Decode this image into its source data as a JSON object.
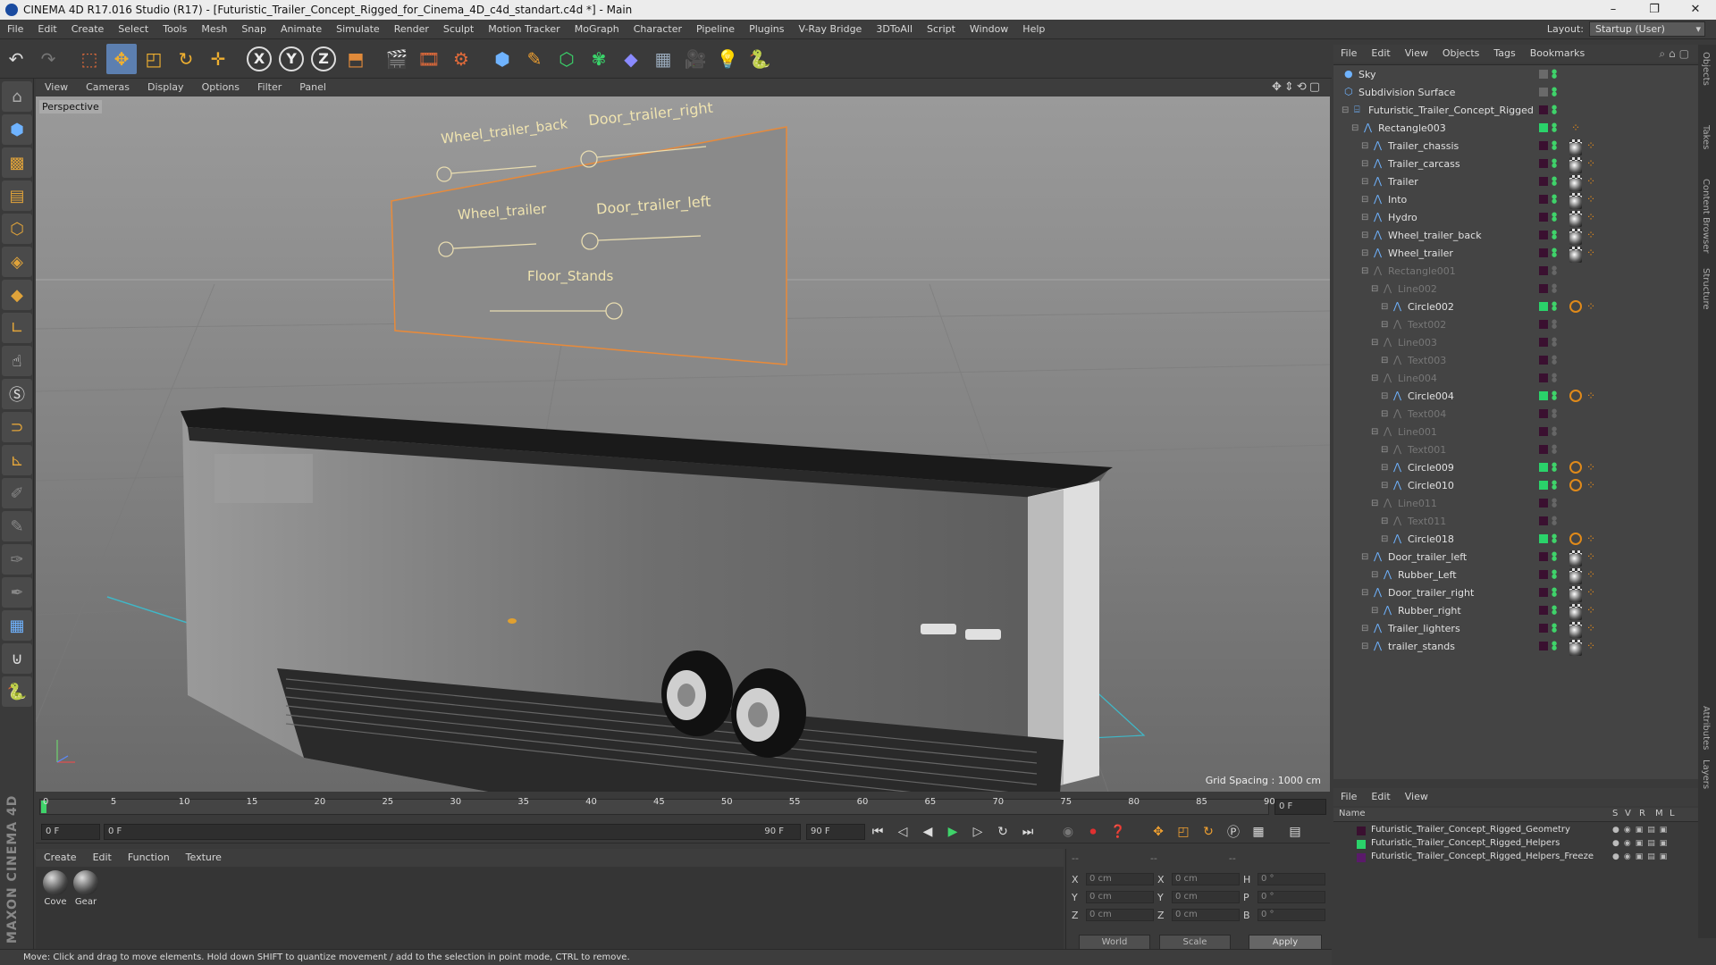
{
  "window": {
    "title": "CINEMA 4D R17.016 Studio (R17) - [Futuristic_Trailer_Concept_Rigged_for_Cinema_4D_c4d_standart.c4d *] - Main",
    "minimize": "–",
    "maximize": "❐",
    "close": "✕"
  },
  "menu": {
    "items": [
      "File",
      "Edit",
      "Create",
      "Select",
      "Tools",
      "Mesh",
      "Snap",
      "Animate",
      "Simulate",
      "Render",
      "Sculpt",
      "Motion Tracker",
      "MoGraph",
      "Character",
      "Pipeline",
      "Plugins",
      "V-Ray Bridge",
      "3DToAll",
      "Script",
      "Window",
      "Help"
    ],
    "layout_label": "Layout:",
    "layout_value": "Startup (User)"
  },
  "toolbar": {
    "axis_x": "X",
    "axis_y": "Y",
    "axis_z": "Z"
  },
  "viewport": {
    "menu": [
      "View",
      "Cameras",
      "Display",
      "Options",
      "Filter",
      "Panel"
    ],
    "label": "Perspective",
    "grid_spacing": "Grid Spacing : 1000 cm",
    "controls": {
      "wheel_trailer_back": "Wheel_trailer_back",
      "door_trailer_right": "Door_trailer_right",
      "wheel_trailer": "Wheel_trailer",
      "door_trailer_left": "Door_trailer_left",
      "floor_stands": "Floor_Stands"
    }
  },
  "timeline": {
    "ticks": [
      "0",
      "5",
      "10",
      "15",
      "20",
      "25",
      "30",
      "35",
      "40",
      "45",
      "50",
      "55",
      "60",
      "65",
      "70",
      "75",
      "80",
      "85",
      "90"
    ],
    "current_frame": "0 F",
    "start_frame": "0 F",
    "range_start": "0 F",
    "range_end": "90 F",
    "end_frame": "90 F"
  },
  "materials": {
    "menu": [
      "Create",
      "Edit",
      "Function",
      "Texture"
    ],
    "items": [
      "Cove",
      "Gear"
    ]
  },
  "coordinates": {
    "header": [
      "--",
      "--",
      "--"
    ],
    "rows": [
      {
        "a": "X",
        "av": "0 cm",
        "b": "X",
        "bv": "0 cm",
        "c": "H",
        "cv": "0 °"
      },
      {
        "a": "Y",
        "av": "0 cm",
        "b": "Y",
        "bv": "0 cm",
        "c": "P",
        "cv": "0 °"
      },
      {
        "a": "Z",
        "av": "0 cm",
        "b": "Z",
        "bv": "0 cm",
        "c": "B",
        "cv": "0 °"
      }
    ],
    "world": "World",
    "scale": "Scale",
    "apply": "Apply"
  },
  "status": "Move: Click and drag to move elements. Hold down SHIFT to quantize movement / add to the selection in point mode, CTRL to remove.",
  "objects": {
    "menu": [
      "File",
      "Edit",
      "View",
      "Objects",
      "Tags",
      "Bookmarks"
    ],
    "rows": [
      {
        "name": "Sky",
        "depth": 0,
        "dim": false,
        "swatch": "",
        "tags": []
      },
      {
        "name": "Subdivision Surface",
        "depth": 0,
        "dim": false,
        "swatch": "",
        "tags": []
      },
      {
        "name": "Futuristic_Trailer_Concept_Rigged",
        "depth": 1,
        "dim": false,
        "swatch": "#3a1030",
        "tags": []
      },
      {
        "name": "Rectangle003",
        "depth": 2,
        "dim": false,
        "swatch": "#2ad36a",
        "tags": [
          "ik"
        ]
      },
      {
        "name": "Trailer_chassis",
        "depth": 3,
        "dim": false,
        "swatch": "#3a1030",
        "tags": [
          "mat",
          "chk",
          "ik"
        ]
      },
      {
        "name": "Trailer_carcass",
        "depth": 3,
        "dim": false,
        "swatch": "#3a1030",
        "tags": [
          "mat",
          "chk",
          "ik"
        ]
      },
      {
        "name": "Trailer",
        "depth": 3,
        "dim": false,
        "swatch": "#3a1030",
        "tags": [
          "mat",
          "chk",
          "ik"
        ]
      },
      {
        "name": "Into",
        "depth": 3,
        "dim": false,
        "swatch": "#3a1030",
        "tags": [
          "mat",
          "chk",
          "ik"
        ]
      },
      {
        "name": "Hydro",
        "depth": 3,
        "dim": false,
        "swatch": "#3a1030",
        "tags": [
          "mat",
          "chk",
          "ik"
        ]
      },
      {
        "name": "Wheel_trailer_back",
        "depth": 3,
        "dim": false,
        "swatch": "#3a1030",
        "tags": [
          "dots",
          "mat",
          "chk",
          "ik"
        ]
      },
      {
        "name": "Wheel_trailer",
        "depth": 3,
        "dim": false,
        "swatch": "#3a1030",
        "tags": [
          "dots",
          "mat",
          "chk",
          "ik"
        ]
      },
      {
        "name": "Rectangle001",
        "depth": 3,
        "dim": true,
        "swatch": "#3a1030",
        "tags": []
      },
      {
        "name": "Line002",
        "depth": 4,
        "dim": true,
        "swatch": "#3a1030",
        "tags": []
      },
      {
        "name": "Circle002",
        "depth": 5,
        "dim": false,
        "swatch": "#2ad36a",
        "tags": [
          "no",
          "ik"
        ]
      },
      {
        "name": "Text002",
        "depth": 5,
        "dim": true,
        "swatch": "#3a1030",
        "tags": []
      },
      {
        "name": "Line003",
        "depth": 4,
        "dim": true,
        "swatch": "#3a1030",
        "tags": []
      },
      {
        "name": "Text003",
        "depth": 5,
        "dim": true,
        "swatch": "#3a1030",
        "tags": []
      },
      {
        "name": "Line004",
        "depth": 4,
        "dim": true,
        "swatch": "#3a1030",
        "tags": []
      },
      {
        "name": "Circle004",
        "depth": 5,
        "dim": false,
        "swatch": "#2ad36a",
        "tags": [
          "no",
          "ik"
        ]
      },
      {
        "name": "Text004",
        "depth": 5,
        "dim": true,
        "swatch": "#3a1030",
        "tags": []
      },
      {
        "name": "Line001",
        "depth": 4,
        "dim": true,
        "swatch": "#3a1030",
        "tags": []
      },
      {
        "name": "Text001",
        "depth": 5,
        "dim": true,
        "swatch": "#3a1030",
        "tags": []
      },
      {
        "name": "Circle009",
        "depth": 5,
        "dim": false,
        "swatch": "#2ad36a",
        "tags": [
          "no",
          "ik"
        ]
      },
      {
        "name": "Circle010",
        "depth": 5,
        "dim": false,
        "swatch": "#2ad36a",
        "tags": [
          "no",
          "ik"
        ]
      },
      {
        "name": "Line011",
        "depth": 4,
        "dim": true,
        "swatch": "#3a1030",
        "tags": []
      },
      {
        "name": "Text011",
        "depth": 5,
        "dim": true,
        "swatch": "#3a1030",
        "tags": []
      },
      {
        "name": "Circle018",
        "depth": 5,
        "dim": false,
        "swatch": "#2ad36a",
        "tags": [
          "no",
          "ik"
        ]
      },
      {
        "name": "Door_trailer_left",
        "depth": 3,
        "dim": false,
        "swatch": "#3a1030",
        "tags": [
          "dots",
          "mat",
          "chk",
          "ik"
        ]
      },
      {
        "name": "Rubber_Left",
        "depth": 4,
        "dim": false,
        "swatch": "#3a1030",
        "tags": [
          "mat",
          "chk",
          "ik"
        ]
      },
      {
        "name": "Door_trailer_right",
        "depth": 3,
        "dim": false,
        "swatch": "#3a1030",
        "tags": [
          "dots",
          "mat",
          "chk",
          "ik"
        ]
      },
      {
        "name": "Rubber_right",
        "depth": 4,
        "dim": false,
        "swatch": "#3a1030",
        "tags": [
          "mat",
          "chk",
          "ik"
        ]
      },
      {
        "name": "Trailer_lighters",
        "depth": 3,
        "dim": false,
        "swatch": "#3a1030",
        "tags": [
          "mat",
          "chk",
          "ik"
        ]
      },
      {
        "name": "trailer_stands",
        "depth": 3,
        "dim": false,
        "swatch": "#3a1030",
        "tags": [
          "dots",
          "mat",
          "chk",
          "ik"
        ]
      }
    ]
  },
  "side_tabs": [
    "Objects",
    "Takes",
    "Content Browser",
    "Structure",
    "Attributes",
    "Layers"
  ],
  "layers": {
    "menu": [
      "File",
      "Edit",
      "View"
    ],
    "headers": {
      "name": "Name",
      "s": "S",
      "v": "V",
      "r": "R",
      "m": "M",
      "l": "L"
    },
    "rows": [
      {
        "name": "Futuristic_Trailer_Concept_Rigged_Geometry",
        "color": "#3a1030"
      },
      {
        "name": "Futuristic_Trailer_Concept_Rigged_Helpers",
        "color": "#2ad36a"
      },
      {
        "name": "Futuristic_Trailer_Concept_Rigged_Helpers_Freeze",
        "color": "#5a1a6a"
      }
    ]
  }
}
